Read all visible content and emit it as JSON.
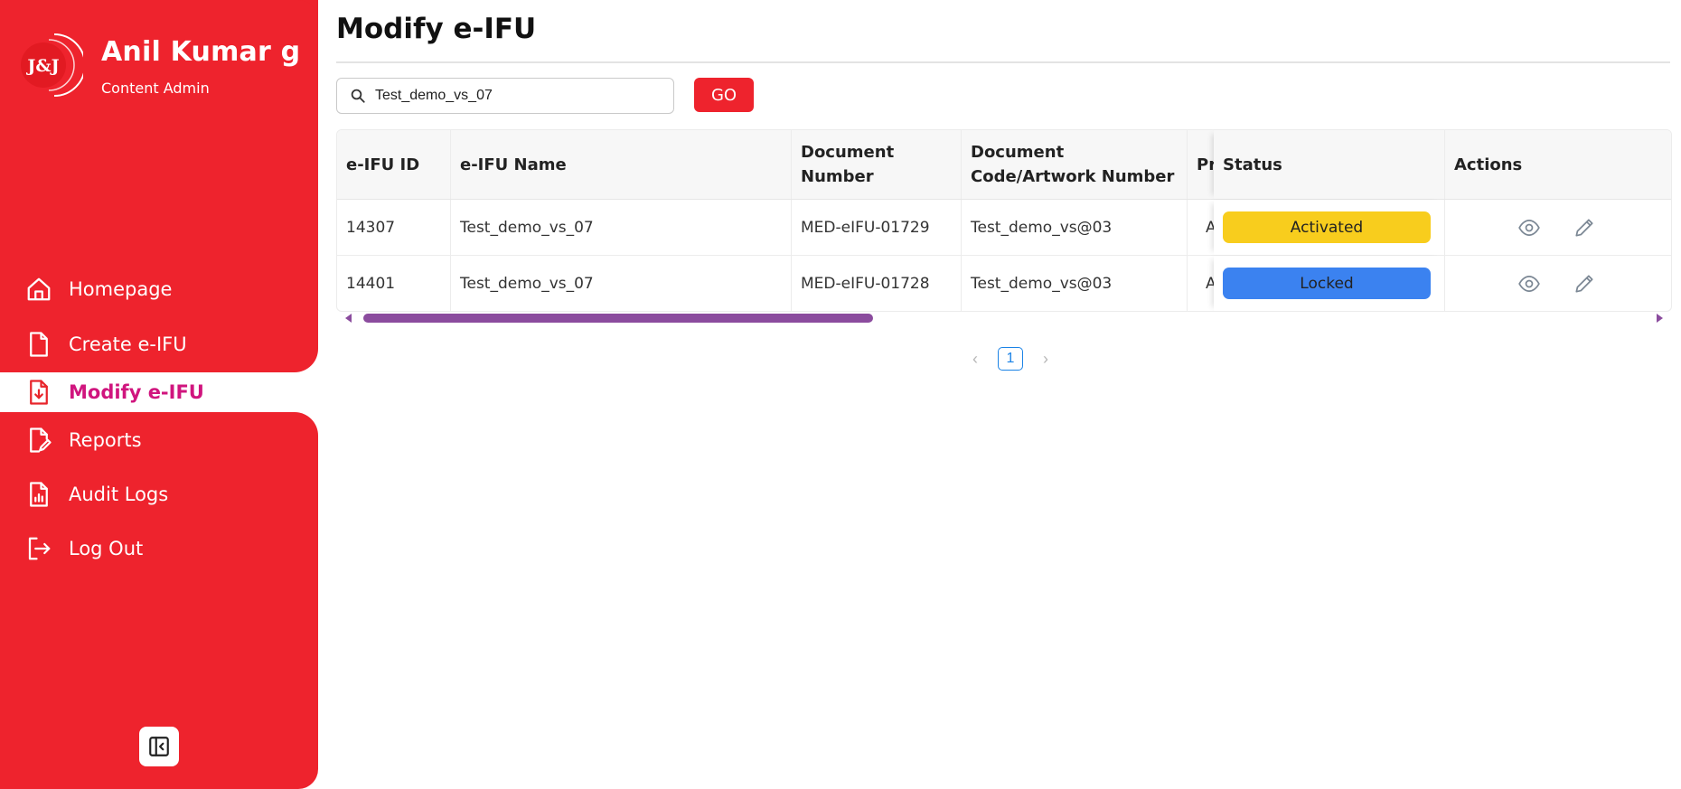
{
  "user": {
    "logo_text": "J&J",
    "name": "Anil Kumar g",
    "role": "Content Admin"
  },
  "sidebar": {
    "items": [
      {
        "label": "Homepage",
        "icon": "home-icon"
      },
      {
        "label": "Create e-IFU",
        "icon": "document-icon"
      },
      {
        "label": "Modify e-IFU",
        "icon": "document-download-icon",
        "active": true
      },
      {
        "label": "Reports",
        "icon": "document-edit-icon"
      },
      {
        "label": "Audit Logs",
        "icon": "document-chart-icon"
      },
      {
        "label": "Log Out",
        "icon": "logout-icon"
      }
    ],
    "collapse_icon": "sidebar-collapse-icon"
  },
  "page": {
    "title": "Modify e-IFU"
  },
  "search": {
    "value": "Test_demo_vs_07",
    "button_label": "GO"
  },
  "table": {
    "columns": [
      "e-IFU ID",
      "e-IFU Name",
      "Document Number",
      "Document Code/Artwork Number",
      "Pr",
      "Status",
      "Actions"
    ],
    "rows": [
      {
        "id": "14307",
        "name": "Test_demo_vs_07",
        "doc_number": "MED-eIFU-01729",
        "doc_code": "Test_demo_vs@03",
        "partial": "A",
        "status": "Activated"
      },
      {
        "id": "14401",
        "name": "Test_demo_vs_07",
        "doc_number": "MED-eIFU-01728",
        "doc_code": "Test_demo_vs@03",
        "partial": "A",
        "status": "Locked"
      }
    ]
  },
  "pagination": {
    "current_page": "1"
  },
  "colors": {
    "brand_red": "#ee232d",
    "active_nav": "#d0157e",
    "status_activated": "#f8cd1d",
    "status_locked": "#3b82f0",
    "scrollbar": "#8b4c9e",
    "pager_accent": "#1b83e6"
  }
}
